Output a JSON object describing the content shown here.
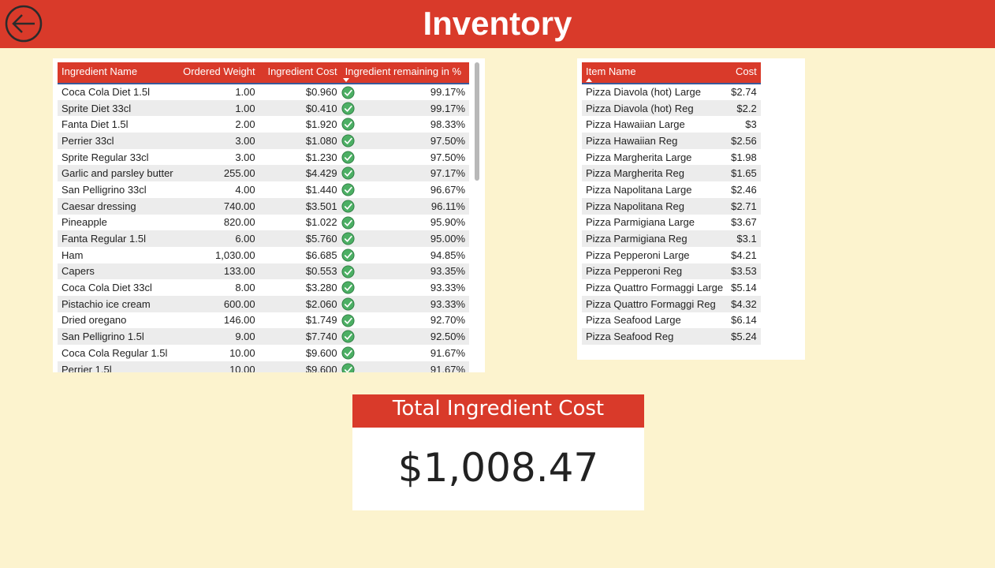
{
  "header": {
    "title": "Inventory",
    "back_icon": "arrow-left-circle-icon"
  },
  "colors": {
    "accent": "#d93a2a",
    "background": "#fcf3ce",
    "check": "#4caf64"
  },
  "ingredients": {
    "columns": [
      "Ingredient Name",
      "Ordered Weight",
      "Ingredient Cost",
      "Ingredient remaining in %"
    ],
    "rows": [
      [
        "Coca Cola Diet 1.5l",
        "1.00",
        "$0.960",
        "99.17%"
      ],
      [
        "Sprite Diet 33cl",
        "1.00",
        "$0.410",
        "99.17%"
      ],
      [
        "Fanta Diet 1.5l",
        "2.00",
        "$1.920",
        "98.33%"
      ],
      [
        "Perrier 33cl",
        "3.00",
        "$1.080",
        "97.50%"
      ],
      [
        "Sprite Regular 33cl",
        "3.00",
        "$1.230",
        "97.50%"
      ],
      [
        "Garlic and parsley butter",
        "255.00",
        "$4.429",
        "97.17%"
      ],
      [
        "San Pelligrino 33cl",
        "4.00",
        "$1.440",
        "96.67%"
      ],
      [
        "Caesar dressing",
        "740.00",
        "$3.501",
        "96.11%"
      ],
      [
        "Pineapple",
        "820.00",
        "$1.022",
        "95.90%"
      ],
      [
        "Fanta Regular 1.5l",
        "6.00",
        "$5.760",
        "95.00%"
      ],
      [
        "Ham",
        "1,030.00",
        "$6.685",
        "94.85%"
      ],
      [
        "Capers",
        "133.00",
        "$0.553",
        "93.35%"
      ],
      [
        "Coca Cola Diet 33cl",
        "8.00",
        "$3.280",
        "93.33%"
      ],
      [
        "Pistachio ice cream",
        "600.00",
        "$2.060",
        "93.33%"
      ],
      [
        "Dried oregano",
        "146.00",
        "$1.749",
        "92.70%"
      ],
      [
        "San Pelligrino 1.5l",
        "9.00",
        "$7.740",
        "92.50%"
      ],
      [
        "Coca Cola Regular 1.5l",
        "10.00",
        "$9.600",
        "91.67%"
      ],
      [
        "Perrier 1.5l",
        "10.00",
        "$9.600",
        "91.67%"
      ]
    ]
  },
  "items": {
    "columns": [
      "Item Name",
      "Cost"
    ],
    "rows": [
      [
        "Pizza Diavola (hot) Large",
        "$2.74"
      ],
      [
        "Pizza Diavola (hot) Reg",
        "$2.2"
      ],
      [
        "Pizza Hawaiian Large",
        "$3"
      ],
      [
        "Pizza Hawaiian Reg",
        "$2.56"
      ],
      [
        "Pizza Margherita Large",
        "$1.98"
      ],
      [
        "Pizza Margherita Reg",
        "$1.65"
      ],
      [
        "Pizza Napolitana Large",
        "$2.46"
      ],
      [
        "Pizza Napolitana Reg",
        "$2.71"
      ],
      [
        "Pizza Parmigiana Large",
        "$3.67"
      ],
      [
        "Pizza Parmigiana Reg",
        "$3.1"
      ],
      [
        "Pizza Pepperoni Large",
        "$4.21"
      ],
      [
        "Pizza Pepperoni Reg",
        "$3.53"
      ],
      [
        "Pizza Quattro Formaggi Large",
        "$5.14"
      ],
      [
        "Pizza Quattro Formaggi Reg",
        "$4.32"
      ],
      [
        "Pizza Seafood Large",
        "$6.14"
      ],
      [
        "Pizza Seafood Reg",
        "$5.24"
      ]
    ]
  },
  "total_card": {
    "title": "Total Ingredient Cost",
    "value": "$1,008.47"
  }
}
